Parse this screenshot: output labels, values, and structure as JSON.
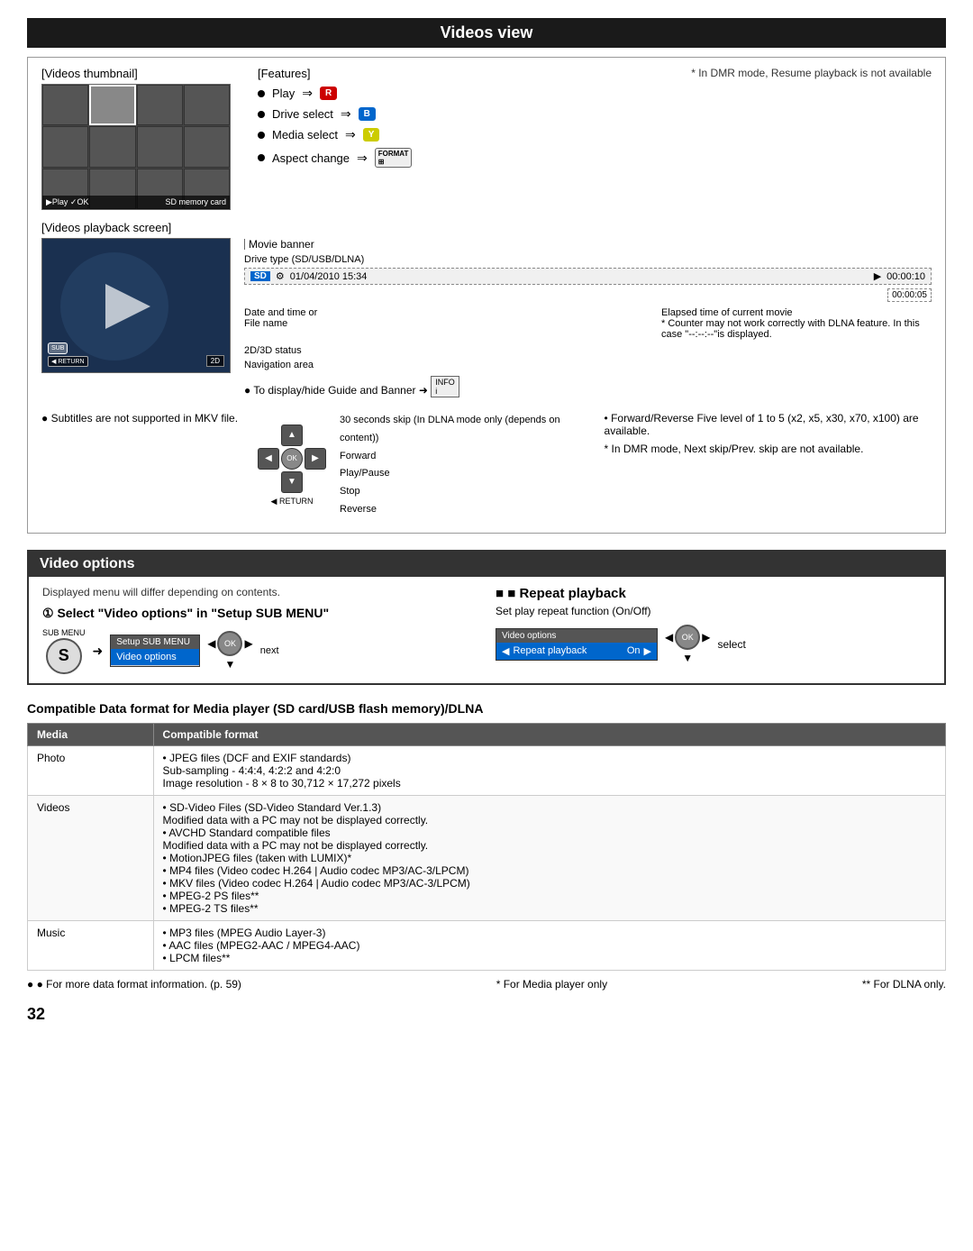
{
  "page": {
    "title": "Videos view",
    "page_number": "32"
  },
  "videos_view": {
    "thumbnail_label": "[Videos thumbnail]",
    "features_label": "[Features]",
    "features": [
      {
        "text": "Play",
        "button": "R",
        "button_color": "red"
      },
      {
        "text": "Drive select",
        "button": "B",
        "button_color": "blue"
      },
      {
        "text": "Media select",
        "button": "Y",
        "button_color": "yellow"
      },
      {
        "text": "Aspect change",
        "button": "FORMAT",
        "button_color": "format"
      }
    ],
    "dmr_note": "* In DMR mode, Resume playback is not available",
    "playback_screen_label": "[Videos playback screen]",
    "movie_banner_label": "Movie banner",
    "drive_type_label": "Drive type (SD/USB/DLNA)",
    "sd_badge": "SD",
    "date_time": "01/04/2010 15:34",
    "time_display": "00:00:10",
    "elapsed_label": "00:00:05",
    "date_time_label": "Date and time or\nFile name",
    "elapsed_note": "Elapsed time of current movie",
    "counter_note": "* Counter may not work correctly with DLNA feature. In this case \"--:--:--\"is displayed.",
    "info_note": "● To display/hide Guide and Banner ➜",
    "status_2d": "2D",
    "status_2d_3d_label": "2D/3D status",
    "nav_area_label": "Navigation area",
    "subtitles_note": "● Subtitles are not supported\nin MKV file.",
    "skip_note": "30 seconds skip (In DLNA mode only (depends on content))",
    "forward_label": "Forward",
    "playpause_label": "Play/Pause",
    "stop_label": "Stop",
    "reverse_label": "Reverse",
    "forward_reverse_note": "Forward/Reverse\nFive level of 1 to 5 (x2, x5, x30, x70, x100) are available.",
    "dmr_skip_note": "* In DMR mode, Next skip/Prev. skip are not available."
  },
  "video_options": {
    "title": "Video options",
    "subtitle": "Displayed menu will differ depending on contents.",
    "step_label": "① Select \"Video options\" in \"Setup SUB MENU\"",
    "sub_menu_label": "SUB\nMENU",
    "sub_icon_letter": "S",
    "setup_sub_menu_title": "Setup SUB MENU",
    "menu_items": [
      {
        "text": "Video options",
        "selected": true
      }
    ],
    "next_label": "next",
    "repeat_title": "■ Repeat playback",
    "repeat_desc": "Set play repeat function (On/Off)",
    "repeat_menu_title": "Video options",
    "repeat_item": "Repeat playback",
    "repeat_value": "On",
    "select_label": "select"
  },
  "compat_table": {
    "title": "Compatible Data format for Media player (SD card/USB flash memory)/DLNA",
    "headers": [
      "Media",
      "Compatible format"
    ],
    "rows": [
      {
        "media": "Photo",
        "format": "• JPEG files (DCF and EXIF standards)\n    Sub-sampling       - 4:4:4, 4:2:2 and 4:2:0\n    Image resolution   - 8 × 8 to 30,712 × 17,272 pixels"
      },
      {
        "media": "Videos",
        "format": "• SD-Video Files (SD-Video Standard Ver.1.3)\n    Modified data with a PC may not be displayed correctly.\n• AVCHD Standard compatible files\n    Modified data with a PC may not be displayed correctly.\n• MotionJPEG files (taken with LUMIX)*\n• MP4 files (Video codec H.264 | Audio codec MP3/AC-3/LPCM)\n• MKV files (Video codec H.264 | Audio codec MP3/AC-3/LPCM)\n• MPEG-2 PS files**\n• MPEG-2 TS files**"
      },
      {
        "media": "Music",
        "format": "• MP3 files (MPEG Audio Layer-3)\n• AAC files (MPEG2-AAC / MPEG4-AAC)\n• LPCM files**"
      }
    ],
    "footer_left": "● For more data format information. (p. 59)",
    "footer_mid": "* For Media player only",
    "footer_right": "** For DLNA only."
  }
}
